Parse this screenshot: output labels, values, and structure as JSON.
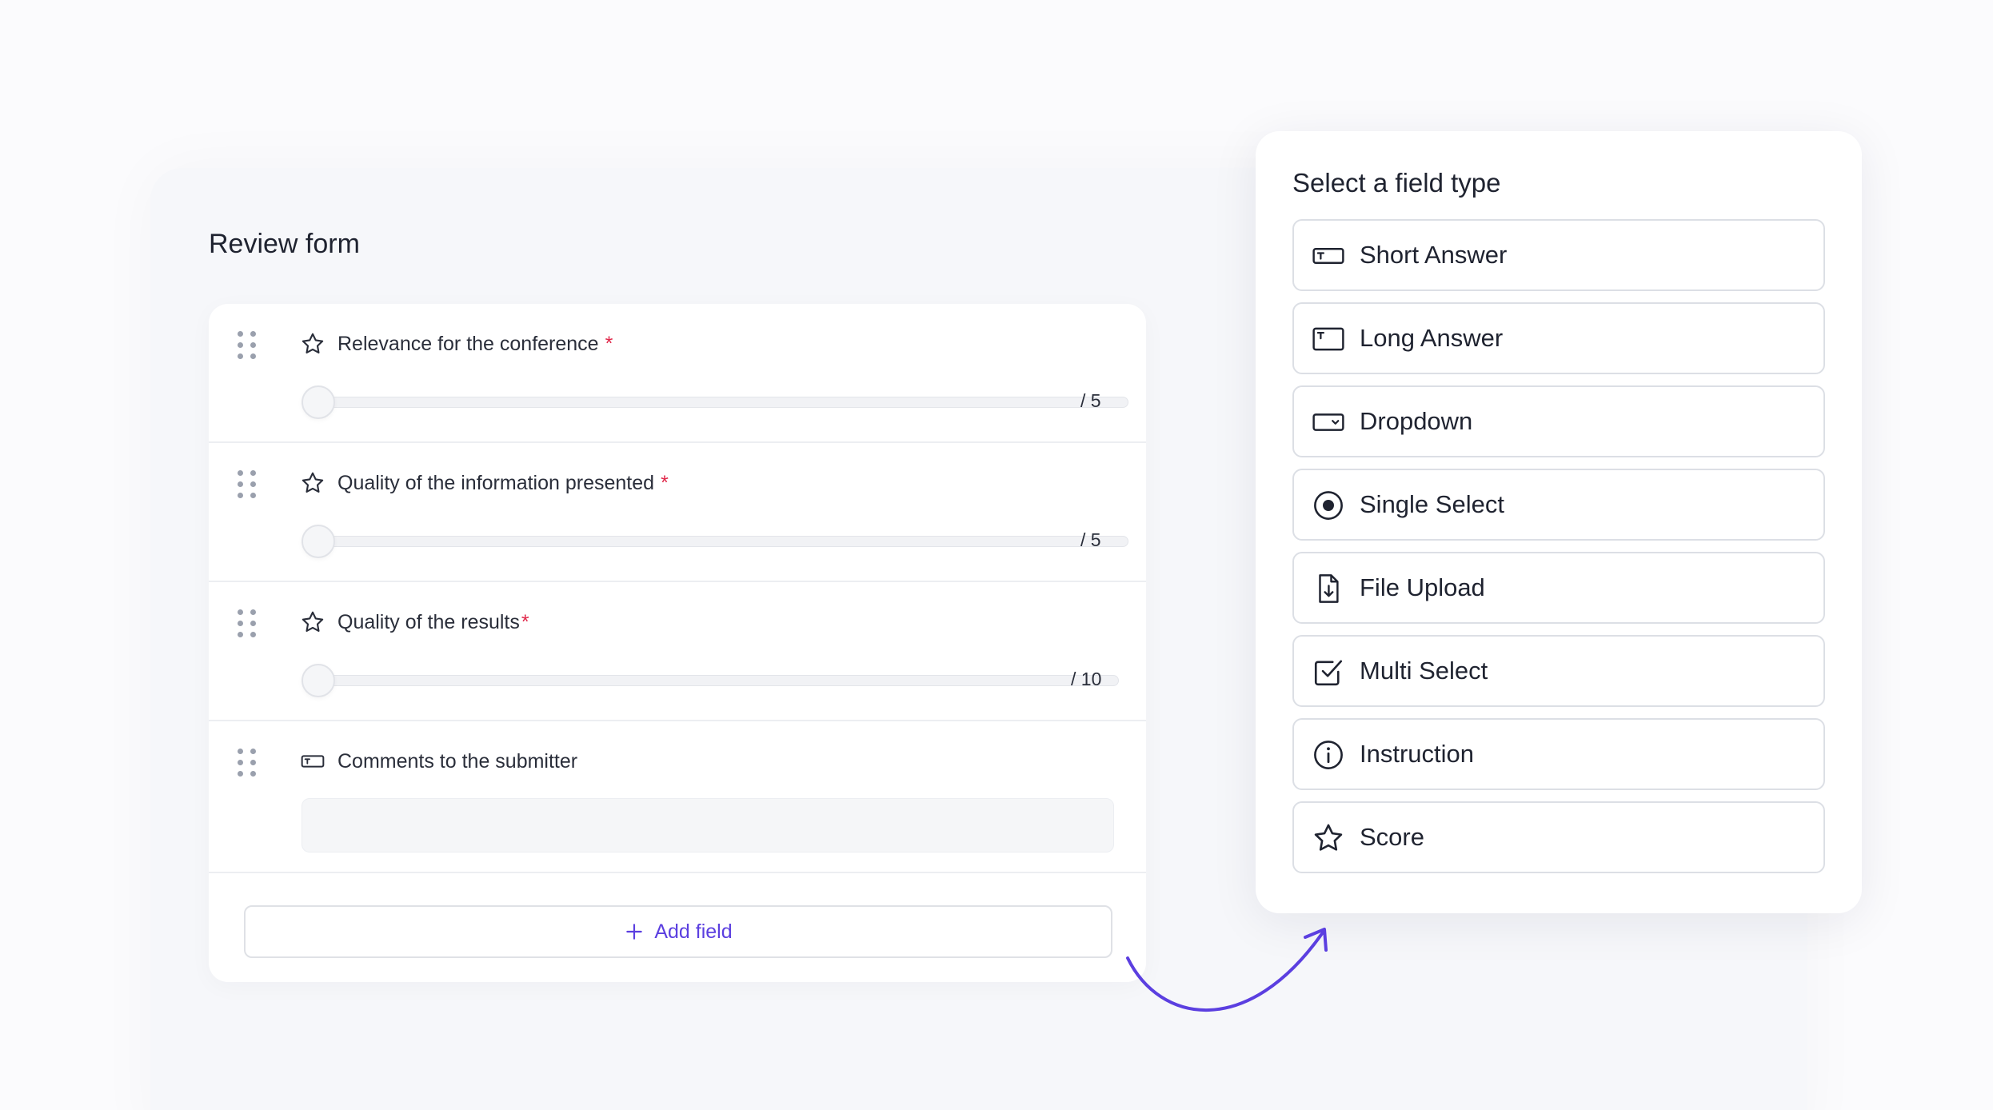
{
  "canvas": {
    "title": "Review form"
  },
  "form": {
    "fields": [
      {
        "label": "Relevance for the conference",
        "required_mark": "*",
        "icon": "star-icon",
        "max_label": "/ 5"
      },
      {
        "label": "Quality of the information presented",
        "required_mark": "*",
        "icon": "star-icon",
        "max_label": "/ 5"
      },
      {
        "label": "Quality of the results",
        "required_mark": "*",
        "icon": "star-icon",
        "max_label": "/ 10"
      },
      {
        "label": "Comments to the submitter",
        "icon": "short-answer-icon",
        "value": ""
      }
    ],
    "add_field_label": "Add field"
  },
  "type_panel": {
    "title": "Select a field type",
    "options": [
      {
        "label": "Short Answer",
        "icon": "short-answer-icon"
      },
      {
        "label": "Long Answer",
        "icon": "long-answer-icon"
      },
      {
        "label": "Dropdown",
        "icon": "dropdown-icon"
      },
      {
        "label": "Single Select",
        "icon": "radio-icon"
      },
      {
        "label": "File Upload",
        "icon": "file-upload-icon"
      },
      {
        "label": "Multi Select",
        "icon": "checkbox-icon"
      },
      {
        "label": "Instruction",
        "icon": "info-icon"
      },
      {
        "label": "Score",
        "icon": "star-icon"
      }
    ]
  },
  "colors": {
    "accent": "#5b3fe0",
    "required": "#e0284a",
    "text": "#1f2330",
    "border": "#dcdfe5"
  }
}
